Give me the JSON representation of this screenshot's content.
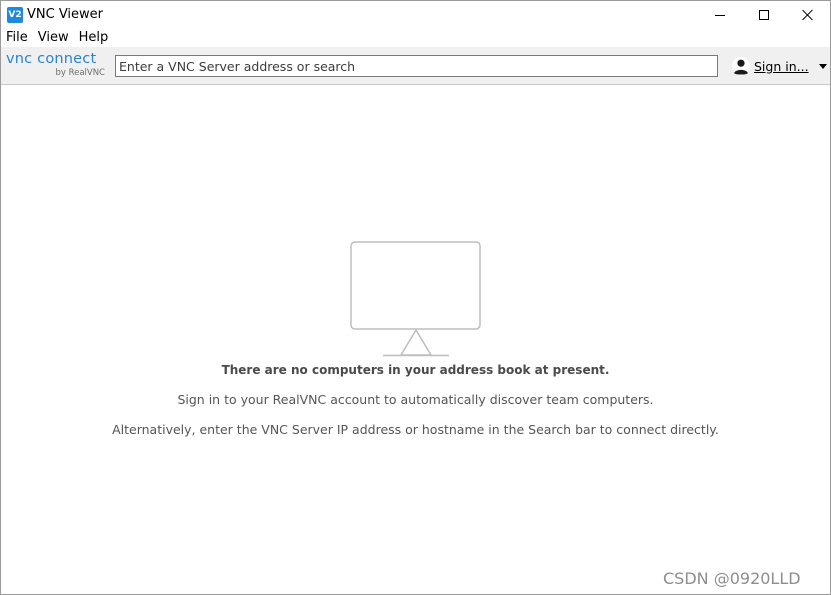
{
  "window": {
    "app_icon_text": "V2",
    "title": "VNC Viewer"
  },
  "menu": {
    "items": [
      "File",
      "View",
      "Help"
    ]
  },
  "toolbar": {
    "brand_main": "vnc connect",
    "brand_sub": "by RealVNC",
    "search_placeholder": "Enter a VNC Server address or search",
    "search_value": "",
    "signin_label": "Sign in..."
  },
  "empty_state": {
    "heading": "There are no computers in your address book at present.",
    "line1": "Sign in to your RealVNC account to automatically discover team computers.",
    "line2": "Alternatively, enter the VNC Server IP address or hostname in the Search bar to connect directly."
  },
  "watermark": "CSDN @0920LLD",
  "colors": {
    "brand_blue": "#2c84cf",
    "app_icon_blue": "#1e88e5",
    "toolbar_bg": "#f0f0f0",
    "monitor_stroke": "#bdbdbd",
    "message_text": "#555555"
  },
  "icons": {
    "app": "vnc-app-icon",
    "minimize": "minimize-icon",
    "maximize": "maximize-icon",
    "close": "close-icon",
    "user": "user-icon",
    "dropdown": "chevron-down-icon",
    "monitor": "monitor-icon"
  }
}
